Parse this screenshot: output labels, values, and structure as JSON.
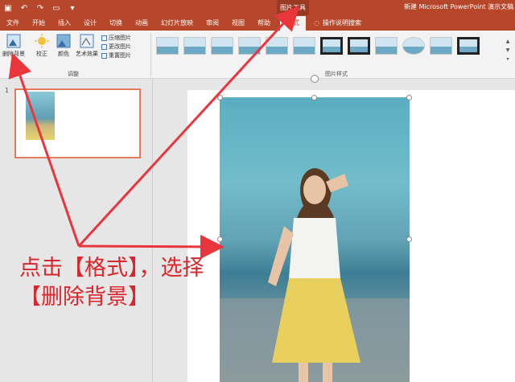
{
  "titlebar": {
    "context_tab_label": "图片工具",
    "doc_title": "新建 Microsoft PowerPoint 演示文稿"
  },
  "tabs": [
    {
      "label": "文件"
    },
    {
      "label": "开始"
    },
    {
      "label": "插入"
    },
    {
      "label": "设计"
    },
    {
      "label": "切换"
    },
    {
      "label": "动画"
    },
    {
      "label": "幻灯片放映"
    },
    {
      "label": "审阅"
    },
    {
      "label": "视图"
    },
    {
      "label": "帮助"
    },
    {
      "label": "格式"
    }
  ],
  "tell_me": "操作说明搜索",
  "ribbon": {
    "remove_bg": "删除背景",
    "corrections": "校正",
    "color": "颜色",
    "artistic": "艺术效果",
    "compress": "压缩图片",
    "change": "更改图片",
    "reset": "重置图片",
    "adjust_group": "调整",
    "styles_group": "图片样式"
  },
  "thumbnails": {
    "slide_number": "1"
  },
  "annotation": {
    "line1": "点击【格式】，选择",
    "line2": "【删除背景】"
  },
  "colors": {
    "accent": "#b7472a",
    "annotation": "#d9252b"
  }
}
